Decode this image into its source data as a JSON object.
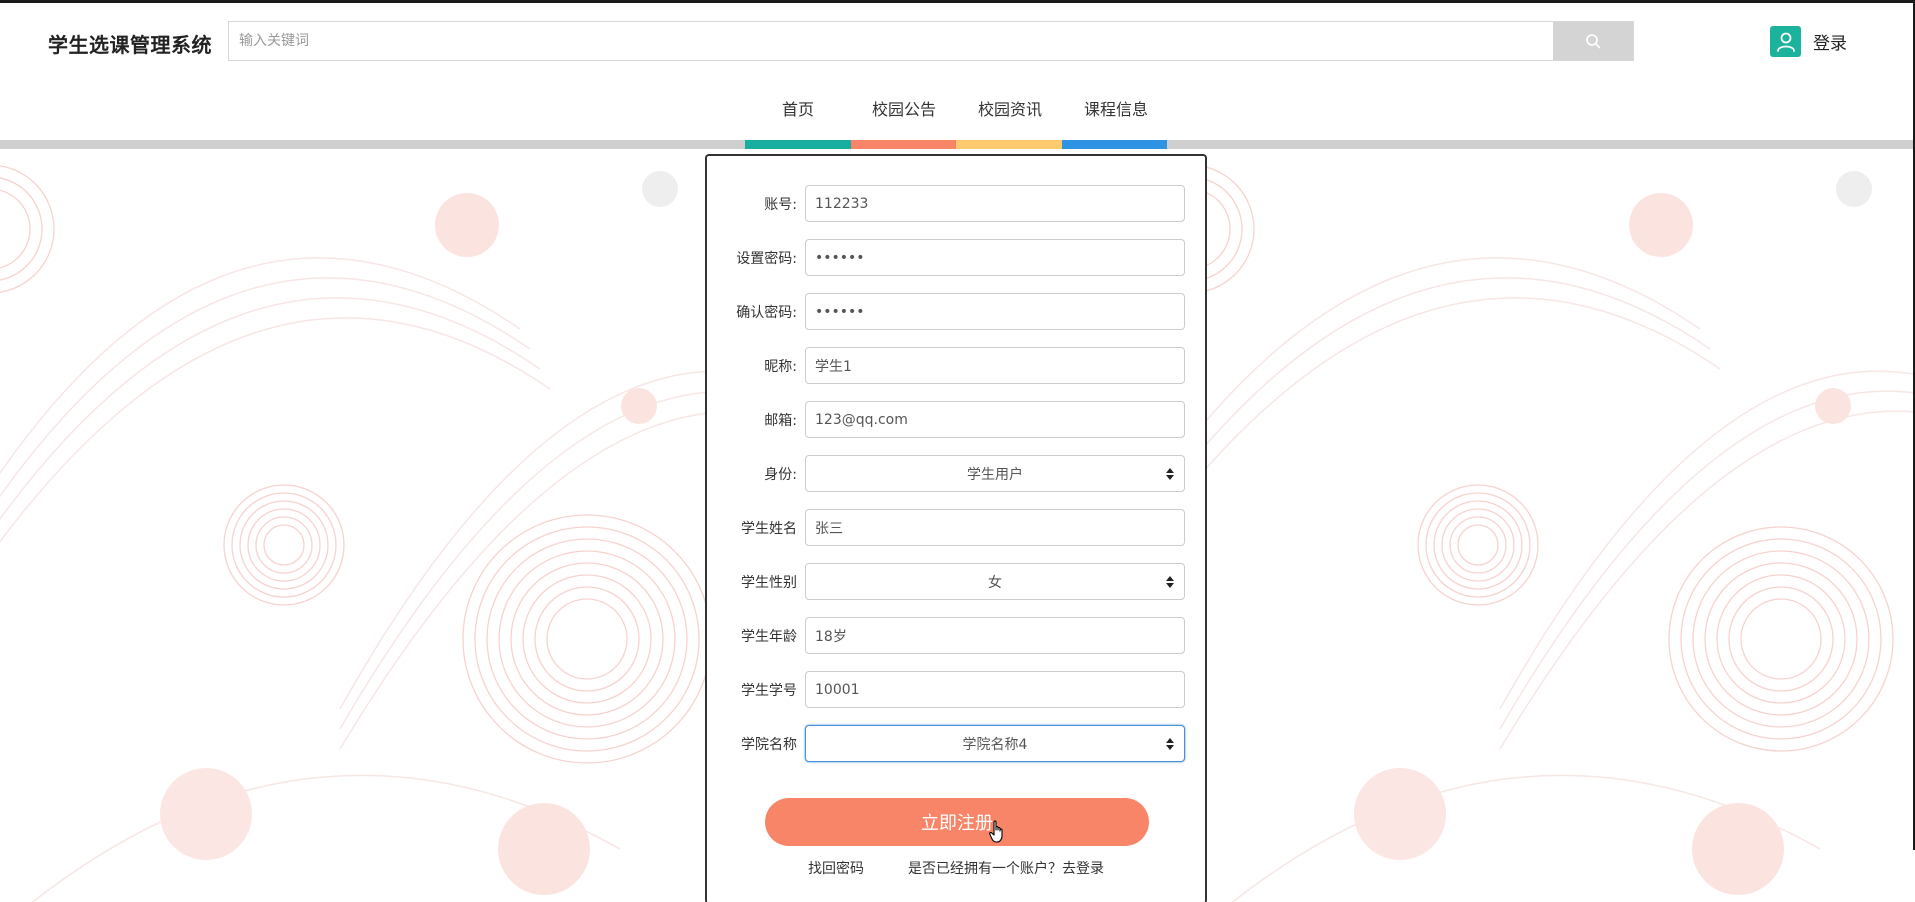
{
  "header": {
    "brand": "学生选课管理系统",
    "search_placeholder": "输入关键词",
    "login_label": "登录"
  },
  "nav": {
    "items": [
      {
        "label": "首页",
        "color": "#18ad9f"
      },
      {
        "label": "校园公告",
        "color": "#f98568"
      },
      {
        "label": "校园资讯",
        "color": "#fdcb6e"
      },
      {
        "label": "课程信息",
        "color": "#2e93e3"
      }
    ]
  },
  "form": {
    "account_label": "账号:",
    "account_value": "112233",
    "password_label": "设置密码:",
    "password_value": "••••••",
    "confirm_label": "确认密码:",
    "confirm_value": "••••••",
    "nickname_label": "昵称:",
    "nickname_value": "学生1",
    "email_label": "邮箱:",
    "email_value": "123@qq.com",
    "role_label": "身份:",
    "role_value": "学生用户",
    "name_label": "学生姓名",
    "name_value": "张三",
    "gender_label": "学生性别",
    "gender_value": "女",
    "age_label": "学生年龄",
    "age_value": "18岁",
    "student_no_label": "学生学号",
    "student_no_value": "10001",
    "college_label": "学院名称",
    "college_value": "学院名称4",
    "submit_label": "立即注册",
    "forgot_label": "找回密码",
    "has_account_label": "是否已经拥有一个账户？去登录"
  },
  "colors": {
    "accent": "#f98568",
    "brand_green": "#1bb39b"
  }
}
